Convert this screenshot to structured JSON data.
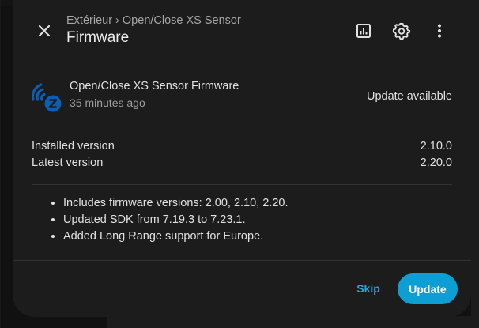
{
  "dialog": {
    "breadcrumb": "Extérieur › Open/Close XS Sensor",
    "title": "Firmware"
  },
  "entity": {
    "name": "Open/Close XS Sensor Firmware",
    "last_changed": "35 minutes ago",
    "state": "Update available",
    "icon": "zwave-icon"
  },
  "versions": {
    "installed_label": "Installed version",
    "installed_value": "2.10.0",
    "latest_label": "Latest version",
    "latest_value": "2.20.0"
  },
  "release_notes": [
    "Includes firmware versions: 2.00, 2.10, 2.20.",
    "Updated SDK from 7.19.3 to 7.23.1.",
    "Added Long Range support for Europe."
  ],
  "actions": {
    "skip_label": "Skip",
    "update_label": "Update"
  },
  "colors": {
    "accent": "#0d9ed4",
    "surface": "#1c1c1c",
    "zwave_blue": "#0a5eb3"
  }
}
